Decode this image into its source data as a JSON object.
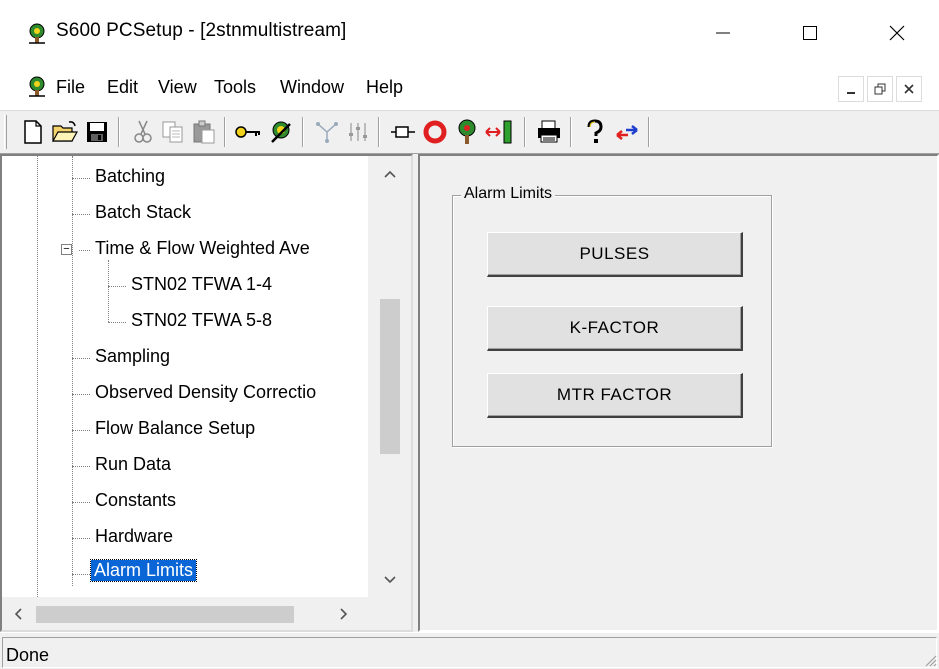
{
  "window": {
    "title": "S600 PCSetup  - [2stnmultistream]",
    "minimize_glyph": "—",
    "maximize_glyph": "☐",
    "close_glyph": "✕"
  },
  "menu": {
    "items": [
      "File",
      "Edit",
      "View",
      "Tools",
      "Window",
      "Help"
    ],
    "mdi_minimize": "_",
    "mdi_restore": "🗗",
    "mdi_close": "✕"
  },
  "toolbar": {
    "buttons": [
      "new-file-icon",
      "open-folder-icon",
      "save-icon",
      "cut-icon",
      "copy-icon",
      "paste-icon",
      "key-icon",
      "tree-bug-icon",
      "network-icon",
      "sliders-icon",
      "component-icon",
      "ring-icon",
      "tree-green-icon",
      "transfer-icon",
      "print-icon",
      "help-icon",
      "swap-arrows-icon"
    ]
  },
  "tree": {
    "items": [
      {
        "label": "Batching",
        "level": 1
      },
      {
        "label": "Batch Stack",
        "level": 1
      },
      {
        "label": "Time & Flow Weighted Ave",
        "level": 1,
        "expanded": true
      },
      {
        "label": "STN02 TFWA 1-4",
        "level": 2
      },
      {
        "label": "STN02 TFWA 5-8",
        "level": 2
      },
      {
        "label": "Sampling",
        "level": 1
      },
      {
        "label": "Observed Density Correctio",
        "level": 1
      },
      {
        "label": "Flow Balance Setup",
        "level": 1
      },
      {
        "label": "Run Data",
        "level": 1
      },
      {
        "label": "Constants",
        "level": 1
      },
      {
        "label": "Hardware",
        "level": 1
      },
      {
        "label": "Alarm Limits",
        "level": 1,
        "selected": true
      }
    ],
    "expander_glyph": "−",
    "scroll_up": "^",
    "scroll_down": "v",
    "scroll_left": "<",
    "scroll_right": ">"
  },
  "panel": {
    "group_title": "Alarm Limits",
    "buttons": [
      "PULSES",
      "K-FACTOR",
      "MTR FACTOR"
    ]
  },
  "status": {
    "text": "Done"
  },
  "colors": {
    "selection": "#0a66d6",
    "face": "#f0f0f0"
  }
}
